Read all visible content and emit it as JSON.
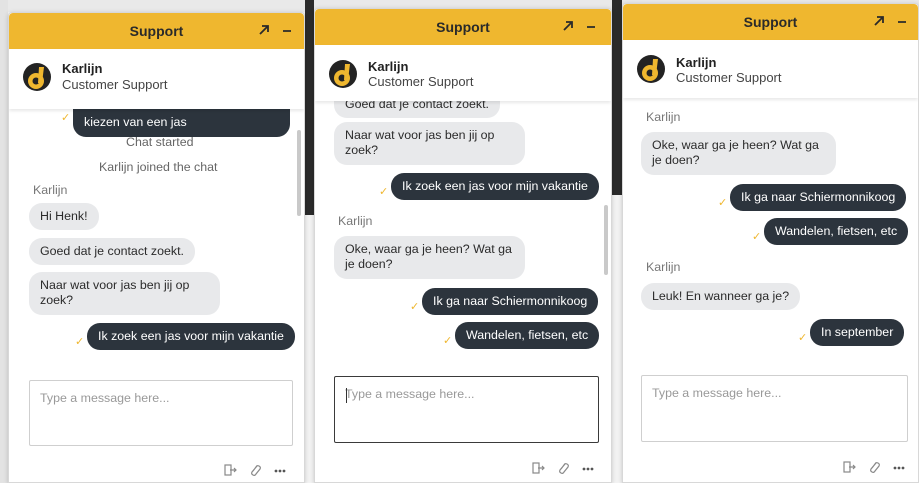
{
  "header": {
    "title": "Support"
  },
  "agent": {
    "name": "Karlijn",
    "role": "Customer Support"
  },
  "composer": {
    "placeholder": "Type a message here..."
  },
  "icons": {
    "popout": "popout-arrow-icon",
    "minimize": "minimize-icon",
    "logout": "logout-icon",
    "attach": "paperclip-icon",
    "more": "ellipsis-icon",
    "read": "check-icon"
  },
  "colors": {
    "header": "#efb72f",
    "outgoing": "#2c343d",
    "incoming": "#e8e9eb",
    "tick": "#efb72f"
  },
  "panel1": {
    "partial_out": "kiezen van een jas",
    "sys1": "Chat started",
    "sys2": "Karlijn joined the chat",
    "sender": "Karlijn",
    "m1": "Hi Henk!",
    "m2": "Goed dat je contact zoekt.",
    "m3_l1": "Naar wat voor jas ben jij op",
    "m3_l2": "zoek?",
    "out1": "Ik zoek een jas voor mijn vakantie"
  },
  "panel2": {
    "m1": "Goed dat je contact zoekt.",
    "m2_l1": "Naar wat voor jas ben jij op",
    "m2_l2": "zoek?",
    "out1": "Ik zoek een jas voor mijn vakantie",
    "sender": "Karlijn",
    "m3_l1": "Oke, waar ga je heen? Wat ga",
    "m3_l2": "je doen?",
    "out2": "Ik ga naar Schiermonnikoog",
    "out3": "Wandelen, fietsen, etc"
  },
  "panel3": {
    "sender1": "Karlijn",
    "m1_l1": "Oke, waar ga je heen? Wat ga",
    "m1_l2": "je doen?",
    "out1": "Ik ga naar Schiermonnikoog",
    "out2": "Wandelen, fietsen, etc",
    "sender2": "Karlijn",
    "m2": "Leuk! En wanneer ga je?",
    "out3": "In september"
  }
}
